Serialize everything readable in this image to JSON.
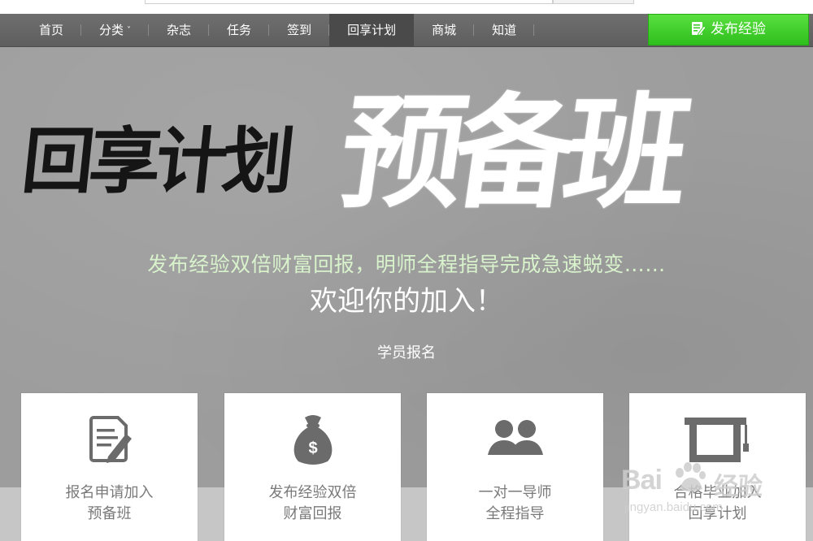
{
  "nav": {
    "items": [
      {
        "label": "首页"
      },
      {
        "label": "分类",
        "caret": "˅"
      },
      {
        "label": "杂志"
      },
      {
        "label": "任务"
      },
      {
        "label": "签到"
      },
      {
        "label": "回享计划",
        "active": true
      },
      {
        "label": "商城"
      },
      {
        "label": "知道"
      }
    ],
    "publish_label": "发布经验"
  },
  "hero": {
    "title_black": "回享计划",
    "title_white": "预备班",
    "subtitle": "发布经验双倍财富回报，明师全程指导完成急速蜕变……",
    "welcome": "欢迎你的加入！",
    "register_link": "学员报名"
  },
  "cards": [
    {
      "icon": "application-form-icon",
      "line1": "报名申请加入",
      "line2": "预备班"
    },
    {
      "icon": "money-bag-icon",
      "line1": "发布经验双倍",
      "line2": "财富回报"
    },
    {
      "icon": "mentor-people-icon",
      "line1": "一对一导师",
      "line2": "全程指导"
    },
    {
      "icon": "graduation-cap-icon",
      "line1": "合格毕业加入",
      "line2": "回享计划"
    }
  ],
  "watermark": {
    "brand": "Bai",
    "brand_suffix": "经验",
    "url": "jingyan.baidu.com"
  },
  "colors": {
    "nav_bg": "#636363",
    "nav_active": "#4a4a4a",
    "publish_green": "#3ccc28",
    "hero_bg": "#9d9d9d",
    "subtitle_green": "#d8f2cc",
    "card_text": "#7a7a7a",
    "icon_gray": "#6b6b6b"
  }
}
